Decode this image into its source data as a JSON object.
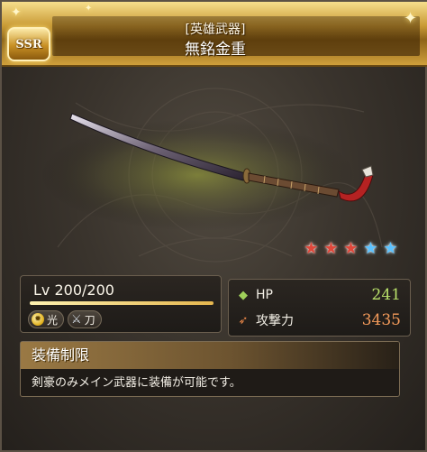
{
  "header": {
    "rarity": "SSR",
    "category": "[英雄武器]",
    "item_name": "無銘金重"
  },
  "rarity_stars": {
    "red": 3,
    "blue": 2
  },
  "level": {
    "text": "Lv 200/200",
    "fraction": 1.0
  },
  "tags": {
    "element_label": "光",
    "weapon_type_label": "刀",
    "element_icon": "light-element-icon",
    "weapon_icon": "katana-icon"
  },
  "stats": {
    "hp_label": "HP",
    "hp_value": "241",
    "atk_label": "攻撃力",
    "atk_value": "3435",
    "hp_icon": "green-diamond-icon",
    "atk_icon": "sword-attack-icon"
  },
  "restriction": {
    "heading": "装備制限",
    "text": "剣豪のみメイン武器に装備が可能です。"
  },
  "colors": {
    "gold": "#c99a35",
    "hp": "#b8e06a",
    "atk": "#f39a5a",
    "star_red": "#e0473a",
    "star_blue": "#5cc2ff"
  }
}
